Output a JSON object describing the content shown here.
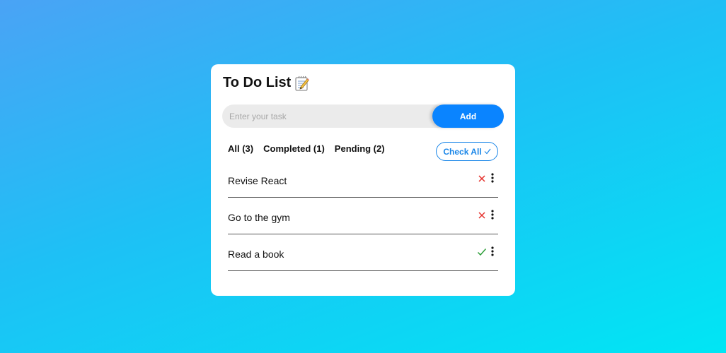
{
  "app": {
    "title": "To Do List",
    "title_icon": "memo-icon"
  },
  "input": {
    "placeholder": "Enter your task",
    "value": ""
  },
  "add_button": {
    "label": "Add"
  },
  "filters": [
    {
      "label": "All (3)"
    },
    {
      "label": "Completed (1)"
    },
    {
      "label": "Pending (2)"
    }
  ],
  "check_all": {
    "label": "Check All",
    "icon": "check-icon"
  },
  "tasks": [
    {
      "text": "Revise React",
      "status": "pending",
      "status_icon": "cross-icon"
    },
    {
      "text": "Go to the gym",
      "status": "pending",
      "status_icon": "cross-icon"
    },
    {
      "text": "Read a book",
      "status": "completed",
      "status_icon": "check-icon"
    }
  ],
  "colors": {
    "accent": "#0a84ff",
    "pending": "#e5322d",
    "completed": "#2e9e3a"
  }
}
